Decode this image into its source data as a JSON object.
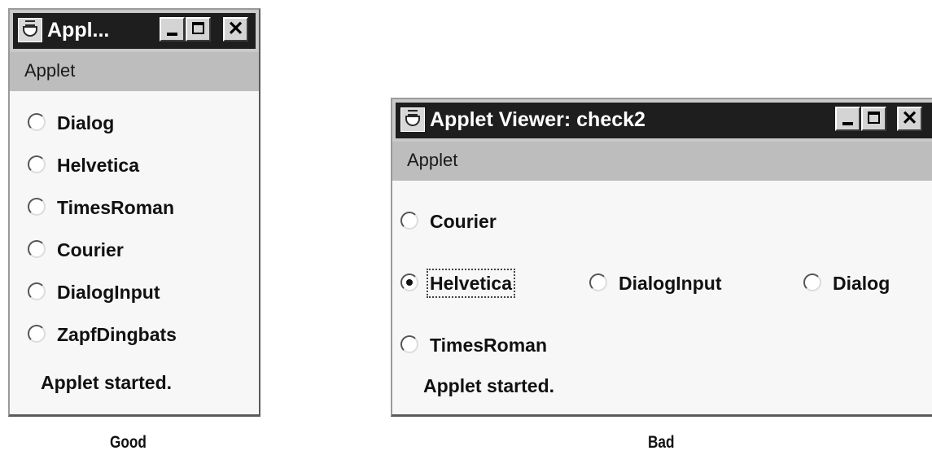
{
  "good_window": {
    "title": "Appl...",
    "menu": "Applet",
    "radios": [
      {
        "label": "Dialog",
        "checked": false
      },
      {
        "label": "Helvetica",
        "checked": false
      },
      {
        "label": "TimesRoman",
        "checked": false
      },
      {
        "label": "Courier",
        "checked": false
      },
      {
        "label": "DialogInput",
        "checked": false
      },
      {
        "label": "ZapfDingbats",
        "checked": false
      }
    ],
    "status": "Applet started.",
    "caption": "Good"
  },
  "bad_window": {
    "title": "Applet Viewer: check2",
    "menu": "Applet",
    "radios": [
      {
        "label": "Courier",
        "checked": false
      },
      {
        "label": "Helvetica",
        "checked": true
      },
      {
        "label": "DialogInput",
        "checked": false
      },
      {
        "label": "Dialog",
        "checked": false
      },
      {
        "label": "TimesRoman",
        "checked": false
      }
    ],
    "status": "Applet started.",
    "caption": "Bad"
  },
  "window_buttons": {
    "close_glyph": "✕"
  },
  "icons": [
    "java-cup-icon",
    "minimize-icon",
    "maximize-icon",
    "close-icon",
    "radio-button"
  ]
}
